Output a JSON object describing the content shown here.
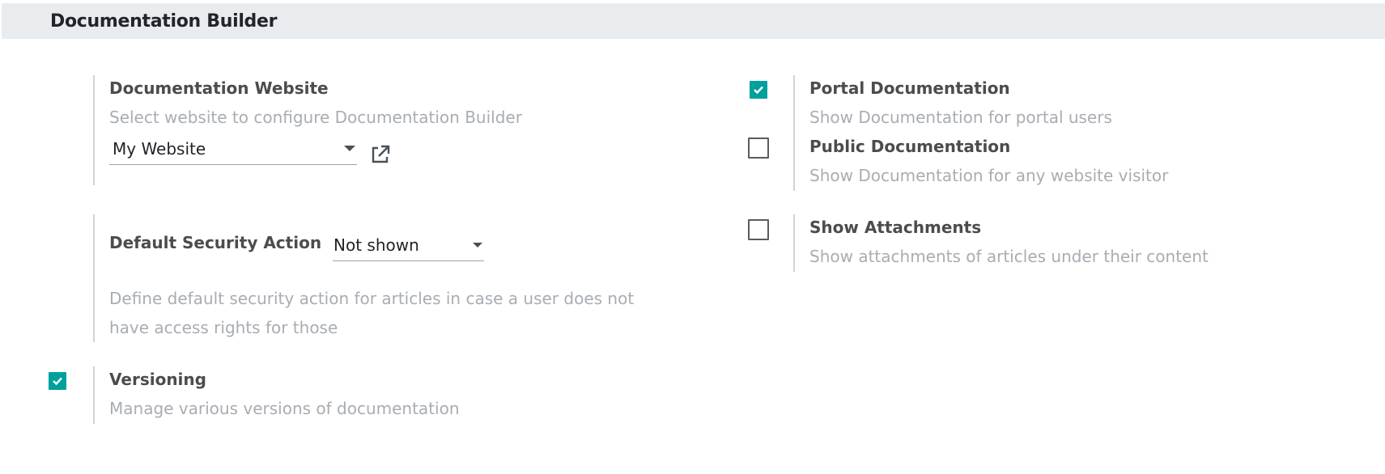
{
  "header": {
    "title": "Documentation Builder"
  },
  "documentation_website": {
    "label": "Documentation Website",
    "description": "Select website to configure Documentation Builder",
    "selected": "My Website"
  },
  "default_security_action": {
    "label": "Default Security Action",
    "selected": "Not shown",
    "description": "Define default security action for articles in case a user does not have access rights for those"
  },
  "versioning": {
    "label": "Versioning",
    "description": "Manage various versions of documentation",
    "checked": true
  },
  "portal_documentation": {
    "label": "Portal Documentation",
    "description": "Show Documentation for portal users",
    "checked": true
  },
  "public_documentation": {
    "label": "Public Documentation",
    "description": "Show Documentation for any website visitor",
    "checked": false
  },
  "show_attachments": {
    "label": "Show Attachments",
    "description": "Show attachments of articles under their content",
    "checked": false
  },
  "colors": {
    "accent": "#00a09d",
    "header_bg": "#e9ecef",
    "muted_text": "#a8adb3"
  }
}
